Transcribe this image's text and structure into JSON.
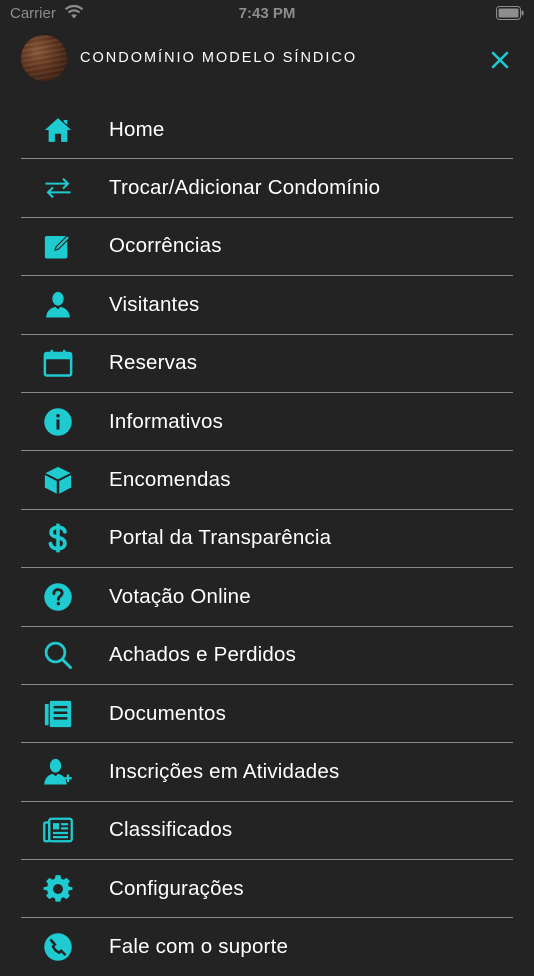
{
  "status_bar": {
    "carrier": "Carrier",
    "time": "7:43 PM"
  },
  "header": {
    "title": "CONDOMÍNIO MODELO SÍNDICO"
  },
  "accent_color": "#1ecbd0",
  "menu": [
    {
      "label": "Home",
      "icon": "home-icon"
    },
    {
      "label": "Trocar/Adicionar Condomínio",
      "icon": "swap-arrows-icon"
    },
    {
      "label": "Ocorrências",
      "icon": "edit-icon"
    },
    {
      "label": "Visitantes",
      "icon": "person-icon"
    },
    {
      "label": "Reservas",
      "icon": "calendar-icon"
    },
    {
      "label": "Informativos",
      "icon": "info-icon"
    },
    {
      "label": "Encomendas",
      "icon": "package-icon"
    },
    {
      "label": "Portal da Transparência",
      "icon": "dollar-icon"
    },
    {
      "label": "Votação Online",
      "icon": "question-icon"
    },
    {
      "label": "Achados e Perdidos",
      "icon": "search-icon"
    },
    {
      "label": "Documentos",
      "icon": "document-icon"
    },
    {
      "label": "Inscrições em Atividades",
      "icon": "person-add-icon"
    },
    {
      "label": "Classificados",
      "icon": "newspaper-icon"
    },
    {
      "label": "Configurações",
      "icon": "gear-icon"
    },
    {
      "label": "Fale com o suporte",
      "icon": "chat-icon"
    }
  ]
}
